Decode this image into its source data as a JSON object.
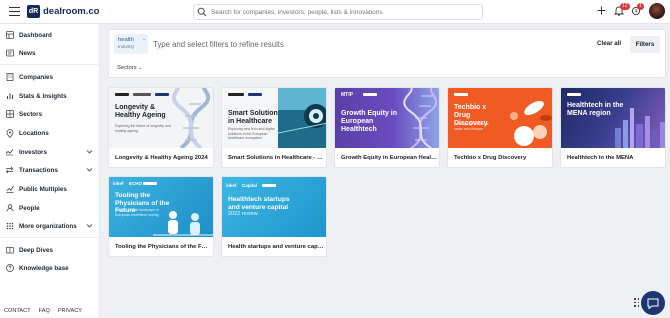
{
  "header": {
    "logo_mark": "dR",
    "brand": "dealroom.co",
    "search_placeholder": "Search for companies, investors, people, lists & innovations",
    "notifications_count": "12",
    "updates_count": "1"
  },
  "sidebar": {
    "items": [
      {
        "label": "Dashboard",
        "icon": "dashboard-icon"
      },
      {
        "label": "News",
        "icon": "news-icon"
      },
      {
        "label": "Companies",
        "icon": "companies-icon"
      },
      {
        "label": "Stats & Insights",
        "icon": "stats-icon"
      },
      {
        "label": "Sectors",
        "icon": "sectors-icon"
      },
      {
        "label": "Locations",
        "icon": "location-icon"
      },
      {
        "label": "Investors",
        "icon": "investors-icon"
      },
      {
        "label": "Transactions",
        "icon": "transactions-icon"
      },
      {
        "label": "Public Multiples",
        "icon": "public-multiples-icon"
      },
      {
        "label": "People",
        "icon": "people-icon"
      },
      {
        "label": "More organizations",
        "icon": "more-organizations-icon"
      },
      {
        "label": "Deep Dives",
        "icon": "deep-dives-icon"
      },
      {
        "label": "Knowledge base",
        "icon": "knowledge-base-icon"
      }
    ],
    "footer": [
      "CONTACT",
      "FAQ",
      "PRIVACY"
    ]
  },
  "filters": {
    "tag_label": "health",
    "tag_category": "Industry",
    "input_placeholder": "Type and select filters to refine results",
    "clear_label": "Clear all",
    "filters_label": "Filters",
    "sectors_label": "Sectors"
  },
  "cards": [
    {
      "title": "Longevity & Healthy Ageing 2024",
      "cover_title": "Longevity & Healthy Ageing",
      "cover_sub": "Exploring the future of longevity and healthy ageing",
      "logos": [
        "LONGEVITY",
        "LONGEVITY",
        "dealroom.co"
      ]
    },
    {
      "title": "Smart Solutions in Healthcare - E...",
      "cover_title": "Smart Solutions in Healthcare",
      "cover_sub": "Exploring new tech and digital solutions in the European healthcare ecosystem",
      "logos": [
        "Smarthealth",
        "dealroom.co"
      ]
    },
    {
      "title": "Growth Equity in European Health...",
      "cover_title": "Growth Equity in European Healthtech",
      "cover_sub": "",
      "logos": [
        "MTIP",
        "dealroom.co"
      ]
    },
    {
      "title": "Techbio x Drug Discovery",
      "cover_title": "Techbio x Drug Discovery",
      "cover_sub": "Developing new drugs faster and cheaper",
      "logos": [
        "dealroom.co"
      ]
    },
    {
      "title": "Healthtech in the MENA",
      "cover_title": "Healthtech in the MENA region",
      "cover_sub": "",
      "logos": [
        "dealroom.co"
      ]
    },
    {
      "title": "Tooling the Physicians of the Future",
      "cover_title": "Tooling the Physicians of the Future",
      "cover_sub": "Venture capital landscape in European healthtech tooling",
      "logos": [
        "inkef",
        "ECHO",
        "dealroom.co"
      ]
    },
    {
      "title": "Health startups and venture capit...",
      "cover_title": "Healthtech startups and venture capital",
      "cover_sub": "2022 review",
      "logos": [
        "inkef",
        "Capital",
        "dealroom.co"
      ]
    }
  ],
  "colors": {
    "brand_navy": "#162a5a",
    "chat_button": "#1d3570",
    "badge_red": "#e0353d"
  }
}
